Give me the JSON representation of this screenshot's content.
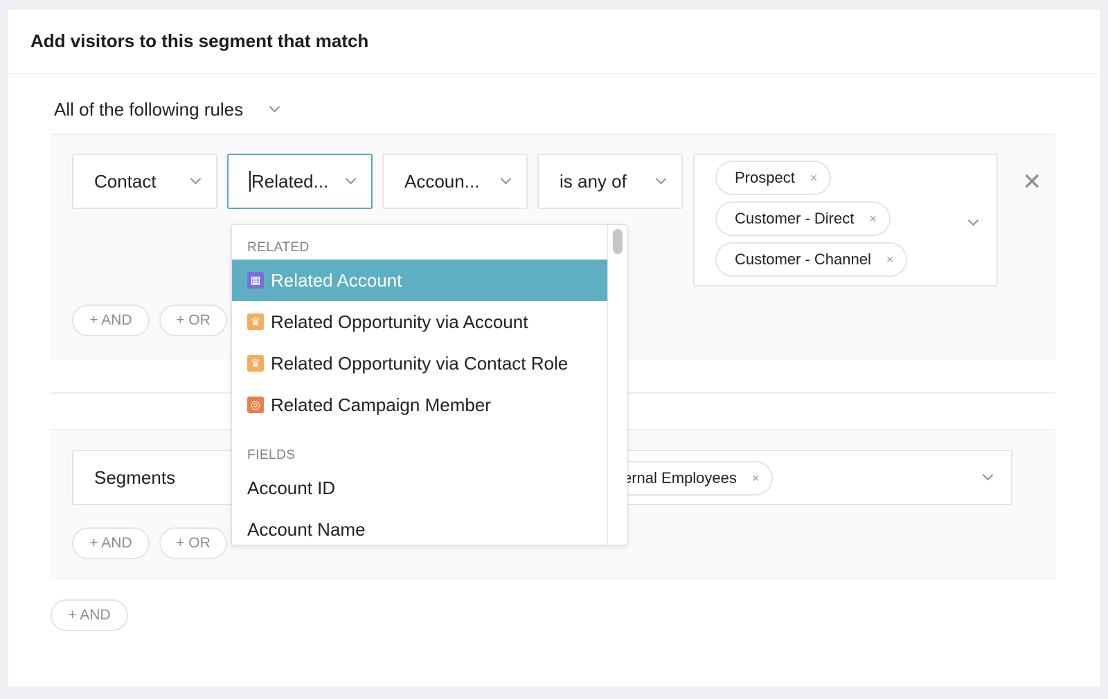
{
  "card": {
    "title": "Add visitors to this segment that match"
  },
  "match": {
    "value": "All of the following rules"
  },
  "rule1": {
    "object": "Contact",
    "relation": "Related...",
    "field": "Accoun...",
    "operator": "is any of",
    "values": [
      "Prospect",
      "Customer - Direct",
      "Customer - Channel"
    ],
    "remove": "✕"
  },
  "group1": {
    "and_label": "+ AND",
    "or_label": "+ OR"
  },
  "rule2": {
    "object": "Segments",
    "value": "ernal Employees"
  },
  "group2": {
    "and_label": "+ AND",
    "or_label": "+ OR"
  },
  "footer": {
    "and_label": "+ AND"
  },
  "tag_remove": "×",
  "dropdown": {
    "related_header": "RELATED",
    "related_items": [
      {
        "label": "Related Account",
        "icon": "building-icon"
      },
      {
        "label": "Related Opportunity via Account",
        "icon": "crown-icon"
      },
      {
        "label": "Related Opportunity via Contact Role",
        "icon": "crown-icon"
      },
      {
        "label": "Related Campaign Member",
        "icon": "target-icon"
      }
    ],
    "fields_header": "FIELDS",
    "field_items": [
      "Account ID",
      "Account Name"
    ]
  },
  "colors": {
    "highlight": "#5fafc2",
    "focus_border": "#5aa9b8",
    "account_icon": "#7a6fd8",
    "opportunity_icon": "#f6ad5b",
    "campaign_icon": "#ee7d4a"
  }
}
